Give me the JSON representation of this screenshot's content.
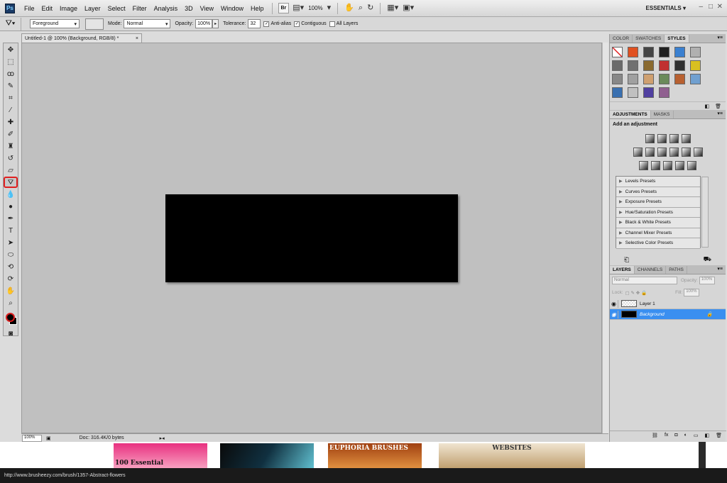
{
  "menubar": {
    "logo": "Ps",
    "items": [
      "File",
      "Edit",
      "Image",
      "Layer",
      "Select",
      "Filter",
      "Analysis",
      "3D",
      "View",
      "Window",
      "Help"
    ],
    "bridge": "Br",
    "zoom": "100%",
    "workspace": "ESSENTIALS"
  },
  "options": {
    "fill": "Foreground",
    "mode_label": "Mode:",
    "mode": "Normal",
    "opacity_label": "Opacity:",
    "opacity": "100%",
    "tolerance_label": "Tolerance:",
    "tolerance": "32",
    "antialias": "Anti-alias",
    "contiguous": "Contiguous",
    "all_layers": "All Layers"
  },
  "document": {
    "tab": "Untitled-1 @ 100% (Background, RGB/8) *",
    "close": "×",
    "zoom": "100%",
    "doc_info": "Doc: 316.4K/0 bytes"
  },
  "styles_panel": {
    "tabs": [
      "COLOR",
      "SWATCHES",
      "STYLES"
    ],
    "swatches": [
      "#ffffff",
      "#e05020",
      "#444444",
      "#202020",
      "#3a80d0",
      "#b0b0b0",
      "#6a6a6a",
      "#707070",
      "#8a6a30",
      "#c03030",
      "#303030",
      "#d8c020",
      "#888888",
      "#a0a0a0",
      "#cfa070",
      "#6a8a5a",
      "#b86030",
      "#70a0d0",
      "#3a70b0",
      "#c0c0c0",
      "#5040a0",
      "#906090"
    ]
  },
  "adjustments": {
    "tabs": [
      "ADJUSTMENTS",
      "MASKS"
    ],
    "title": "Add an adjustment",
    "presets": [
      "Levels Presets",
      "Curves Presets",
      "Exposure Presets",
      "Hue/Saturation Presets",
      "Black & White Presets",
      "Channel Mixer Presets",
      "Selective Color Presets"
    ]
  },
  "layers": {
    "tabs": [
      "LAYERS",
      "CHANNELS",
      "PATHS"
    ],
    "blend": "Normal",
    "opacity_label": "Opacity:",
    "opacity": "100%",
    "lock_label": "Lock:",
    "fill_label": "Fill:",
    "fill": "100%",
    "rows": [
      {
        "name": "Layer 1"
      },
      {
        "name": "Background"
      }
    ]
  },
  "browser": {
    "status_url": "http://www.brusheezy.com/brush/1357-Abstract-flowers",
    "thumb_texts": [
      "100 Essential",
      "",
      "EUPHORIA BRUSHES",
      "WEBSITES"
    ]
  }
}
